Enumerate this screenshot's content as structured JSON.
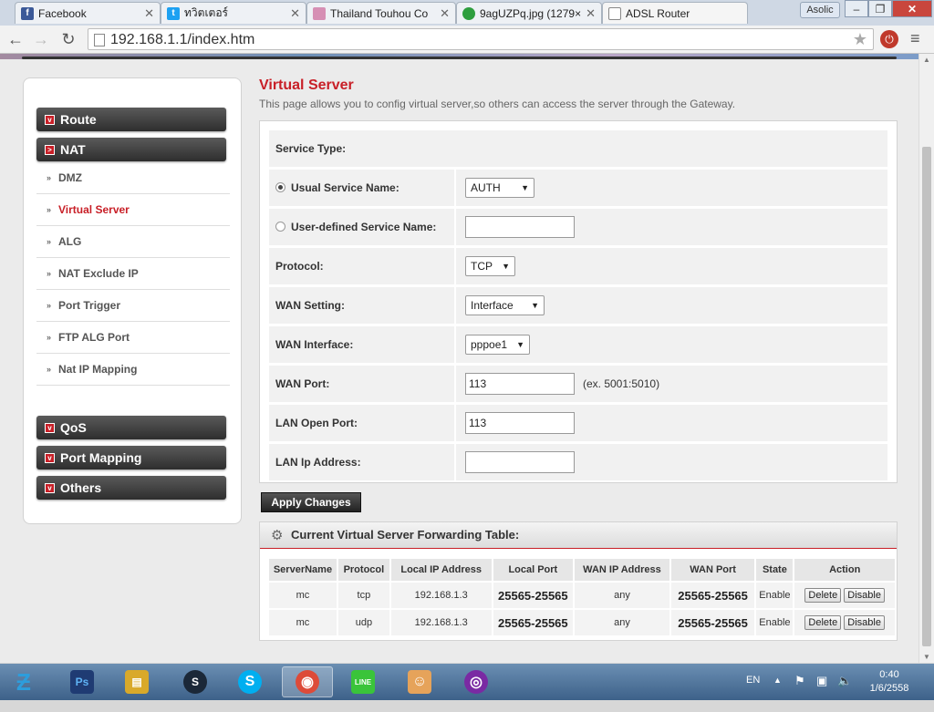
{
  "browser": {
    "tabs": [
      {
        "title": "Facebook",
        "icon": "facebook-icon",
        "color": "#3b5998"
      },
      {
        "title": "ทวิตเตอร์",
        "icon": "twitter-icon",
        "color": "#1da1f2"
      },
      {
        "title": "Thailand Touhou Co",
        "icon": "image-icon",
        "color": "#d68fb4"
      },
      {
        "title": "9agUZPq.jpg (1279×",
        "icon": "image-icon",
        "color": "#2e9e3e"
      },
      {
        "title": "ADSL Router",
        "icon": "page-icon",
        "color": "#888888"
      }
    ],
    "user": "Asolic",
    "url": "192.168.1.1/index.htm"
  },
  "sidebar": {
    "groups_top": [
      {
        "label": "Route",
        "mark": "v"
      },
      {
        "label": "NAT",
        "mark": ">"
      }
    ],
    "nat_items": [
      {
        "label": "DMZ"
      },
      {
        "label": "Virtual Server",
        "active": true
      },
      {
        "label": "ALG"
      },
      {
        "label": "NAT Exclude IP"
      },
      {
        "label": "Port Trigger"
      },
      {
        "label": "FTP ALG Port"
      },
      {
        "label": "Nat IP Mapping"
      }
    ],
    "groups_bottom": [
      {
        "label": "QoS",
        "mark": "v"
      },
      {
        "label": "Port Mapping",
        "mark": "v"
      },
      {
        "label": "Others",
        "mark": "v"
      }
    ]
  },
  "main": {
    "title": "Virtual Server",
    "description": "This page allows you to config virtual server,so others can access the server through the Gateway.",
    "form": {
      "service_type_label": "Service Type:",
      "usual_service_label": "Usual Service Name:",
      "usual_service_value": "AUTH",
      "user_defined_label": "User-defined Service Name:",
      "user_defined_value": "",
      "protocol_label": "Protocol:",
      "protocol_value": "TCP",
      "wan_setting_label": "WAN Setting:",
      "wan_setting_value": "Interface",
      "wan_interface_label": "WAN Interface:",
      "wan_interface_value": "pppoe1",
      "wan_port_label": "WAN Port:",
      "wan_port_value": "113",
      "wan_port_hint": "(ex. 5001:5010)",
      "lan_open_port_label": "LAN Open Port:",
      "lan_open_port_value": "113",
      "lan_ip_label": "LAN Ip Address:",
      "lan_ip_value": ""
    },
    "apply_label": "Apply Changes",
    "table": {
      "title": "Current Virtual Server Forwarding Table:",
      "headers": [
        "ServerName",
        "Protocol",
        "Local IP Address",
        "Local Port",
        "WAN IP Address",
        "WAN Port",
        "State",
        "Action"
      ],
      "rows": [
        {
          "name": "mc",
          "protocol": "tcp",
          "local_ip": "192.168.1.3",
          "local_port": "25565-25565",
          "wan_ip": "any",
          "wan_port": "25565-25565",
          "state": "Enable",
          "delete": "Delete",
          "disable": "Disable"
        },
        {
          "name": "mc",
          "protocol": "udp",
          "local_ip": "192.168.1.3",
          "local_port": "25565-25565",
          "wan_ip": "any",
          "wan_port": "25565-25565",
          "state": "Enable",
          "delete": "Delete",
          "disable": "Disable"
        }
      ]
    }
  },
  "taskbar": {
    "apps": [
      {
        "name": "photoshop",
        "label": "Ps",
        "color": "#1f3b73"
      },
      {
        "name": "file-explorer",
        "label": "▤",
        "color": "#d9a92a"
      },
      {
        "name": "steam",
        "label": "S",
        "color": "#1b2838"
      },
      {
        "name": "skype",
        "label": "S",
        "color": "#00aff0"
      },
      {
        "name": "chrome",
        "label": "◉",
        "color": "#dd4b39"
      },
      {
        "name": "line",
        "label": "LINE",
        "color": "#3ac43a"
      },
      {
        "name": "anime-app",
        "label": "☺",
        "color": "#e6a35a"
      },
      {
        "name": "osu",
        "label": "◎",
        "color": "#7a2aa3"
      }
    ],
    "language": "EN",
    "time": "0:40",
    "date": "1/6/2558"
  }
}
